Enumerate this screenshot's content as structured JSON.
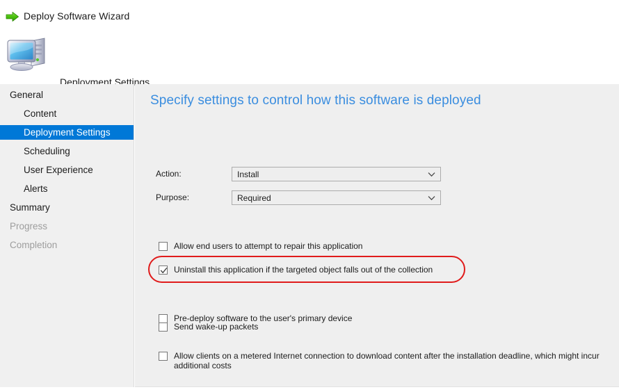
{
  "window": {
    "title": "Deploy Software Wizard",
    "title_icon": "green-right-arrow-icon"
  },
  "page_header": {
    "icon": "computer-icon",
    "title": "Deployment Settings"
  },
  "sidebar": {
    "items": [
      {
        "label": "General",
        "level": 0,
        "selected": false,
        "disabled": false
      },
      {
        "label": "Content",
        "level": 1,
        "selected": false,
        "disabled": false
      },
      {
        "label": "Deployment Settings",
        "level": 1,
        "selected": true,
        "disabled": false
      },
      {
        "label": "Scheduling",
        "level": 1,
        "selected": false,
        "disabled": false
      },
      {
        "label": "User Experience",
        "level": 1,
        "selected": false,
        "disabled": false
      },
      {
        "label": "Alerts",
        "level": 1,
        "selected": false,
        "disabled": false
      },
      {
        "label": "Summary",
        "level": 0,
        "selected": false,
        "disabled": false
      },
      {
        "label": "Progress",
        "level": 0,
        "selected": false,
        "disabled": true
      },
      {
        "label": "Completion",
        "level": 0,
        "selected": false,
        "disabled": true
      }
    ]
  },
  "content": {
    "heading": "Specify settings to control how this software is deployed",
    "fields": [
      {
        "label": "Action:",
        "value": "Install"
      },
      {
        "label": "Purpose:",
        "value": "Required"
      }
    ],
    "checkboxes": [
      {
        "label": "Allow end users to attempt to repair this application",
        "checked": false,
        "highlighted": false
      },
      {
        "label": "Uninstall this application if the targeted object falls out of the collection",
        "checked": true,
        "highlighted": true
      },
      {
        "label": "Pre-deploy software to the user's primary device",
        "checked": false,
        "highlighted": false
      },
      {
        "label": "Send wake-up packets",
        "checked": false,
        "highlighted": false
      },
      {
        "label": "Allow clients on a metered Internet connection to download content after the installation deadline, which might incur additional costs",
        "checked": false,
        "highlighted": false
      }
    ]
  },
  "colors": {
    "selection_blue": "#0078d7",
    "heading_blue": "#3a8ddf",
    "highlight_red": "#e01b1b",
    "panel_gray": "#efefef",
    "sidebar_gray": "#f0f0f0",
    "disabled_text": "#9d9d9d"
  }
}
